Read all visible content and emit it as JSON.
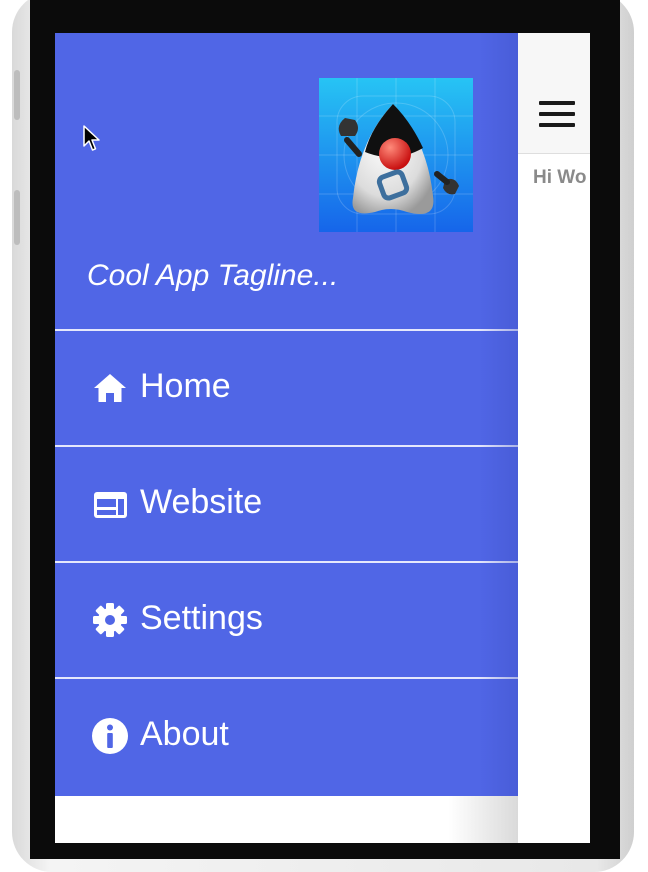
{
  "drawer": {
    "tagline": "Cool App Tagline...",
    "logo_icon": "duke-mascot-logo",
    "accent_color": "#5066e6",
    "items": [
      {
        "label": "Home",
        "icon": "home-icon"
      },
      {
        "label": "Website",
        "icon": "web-icon"
      },
      {
        "label": "Settings",
        "icon": "gear-icon"
      },
      {
        "label": "About",
        "icon": "info-icon"
      }
    ]
  },
  "main": {
    "text": "Hi Wo",
    "menu_icon": "hamburger-icon"
  }
}
